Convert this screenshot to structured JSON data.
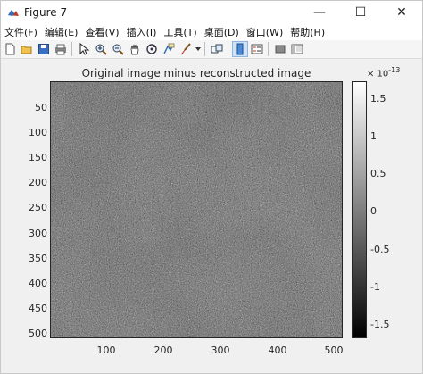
{
  "window": {
    "title": "Figure 7",
    "controls": {
      "minimize": "—",
      "maximize": "☐",
      "close": "✕"
    }
  },
  "menu": [
    "文件(F)",
    "编辑(E)",
    "查看(V)",
    "插入(I)",
    "工具(T)",
    "桌面(D)",
    "窗口(W)",
    "帮助(H)"
  ],
  "toolbar": {
    "buttons": [
      "new-figure-icon",
      "open-file-icon",
      "save-icon",
      "print-icon",
      "select-arrow-icon",
      "zoom-in-icon",
      "zoom-out-icon",
      "pan-hand-icon",
      "rotate-3d-icon",
      "data-cursor-icon",
      "brush-icon",
      "link-plot-icon",
      "colorbar-icon",
      "legend-icon",
      "hide-plot-tools-icon",
      "show-plot-tools-icon"
    ]
  },
  "plot": {
    "title": "Original image minus reconstructed image",
    "y_ticks": [
      "50",
      "100",
      "150",
      "200",
      "250",
      "300",
      "350",
      "400",
      "450",
      "500"
    ],
    "x_ticks": [
      "100",
      "200",
      "300",
      "400",
      "500"
    ],
    "colorbar_ticks": [
      "1.5",
      "1",
      "0.5",
      "0",
      "-0.5",
      "-1",
      "-1.5"
    ],
    "colorbar_exponent_base": "× 10",
    "colorbar_exponent": "-13"
  },
  "chart_data": {
    "type": "heatmap",
    "title": "Original image minus reconstructed image",
    "xlabel": "",
    "ylabel": "",
    "xlim": [
      0.5,
      512.5
    ],
    "ylim": [
      512.5,
      0.5
    ],
    "x_ticks": [
      100,
      200,
      300,
      400,
      500
    ],
    "y_ticks": [
      50,
      100,
      150,
      200,
      250,
      300,
      350,
      400,
      450,
      500
    ],
    "colormap": "gray",
    "clim": [
      -1.8e-13,
      1.8e-13
    ],
    "colorbar_ticks": [
      -1.5e-13,
      -1e-13,
      -5e-14,
      0,
      5e-14,
      1e-13,
      1.5e-13
    ],
    "colorbar_scale_label": "×10^-13",
    "grid": false
  }
}
